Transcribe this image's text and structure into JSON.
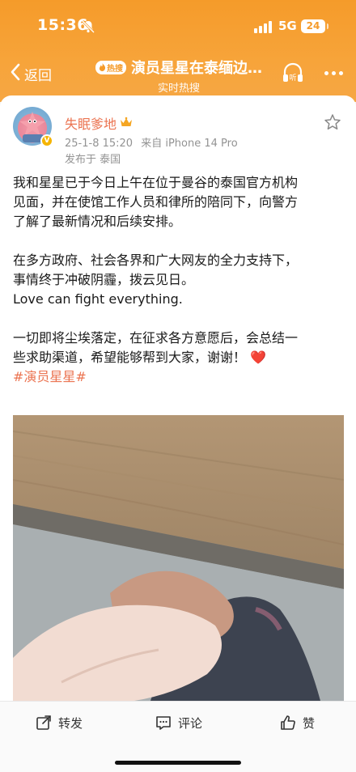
{
  "status_bar": {
    "time": "15:36",
    "network": "5G",
    "battery": "24",
    "icons": [
      "bell-off-icon",
      "signal-icon",
      "battery-icon"
    ]
  },
  "nav": {
    "back_label": "返回",
    "hot_badge": "热搜",
    "title": "演员星星在泰缅边…",
    "subtitle": "实时热搜",
    "listen_label": "听"
  },
  "post": {
    "author": "失眠爹地",
    "timestamp": "25-1-8 15:20",
    "source": "来自 iPhone 14 Pro",
    "location": "发布于 泰国",
    "paragraphs": [
      [
        "我和星星已于今日上午在位于曼谷的泰国官方机构",
        "见面，并在使馆工作人员和律所的陪同下，向警方",
        "了解了最新情况和后续安排。"
      ],
      [
        "在多方政府、社会各界和广大网友的全力支持下，",
        "事情终于冲破阴霾，拨云见日。",
        "Love can fight everything."
      ]
    ],
    "para3_line1": "一切即将尘埃落定，在征求各方意愿后，会总结一",
    "para3_line2": "些求助渠道，希望能够帮到大家，谢谢！",
    "heart": "❤️",
    "hashtag": "#演员星星#"
  },
  "actions": {
    "repost": "转发",
    "comment": "评论",
    "like": "赞"
  },
  "colors": {
    "header_orange": "#f59b2a",
    "accent": "#eb7350",
    "heart": "#e62b2b"
  }
}
